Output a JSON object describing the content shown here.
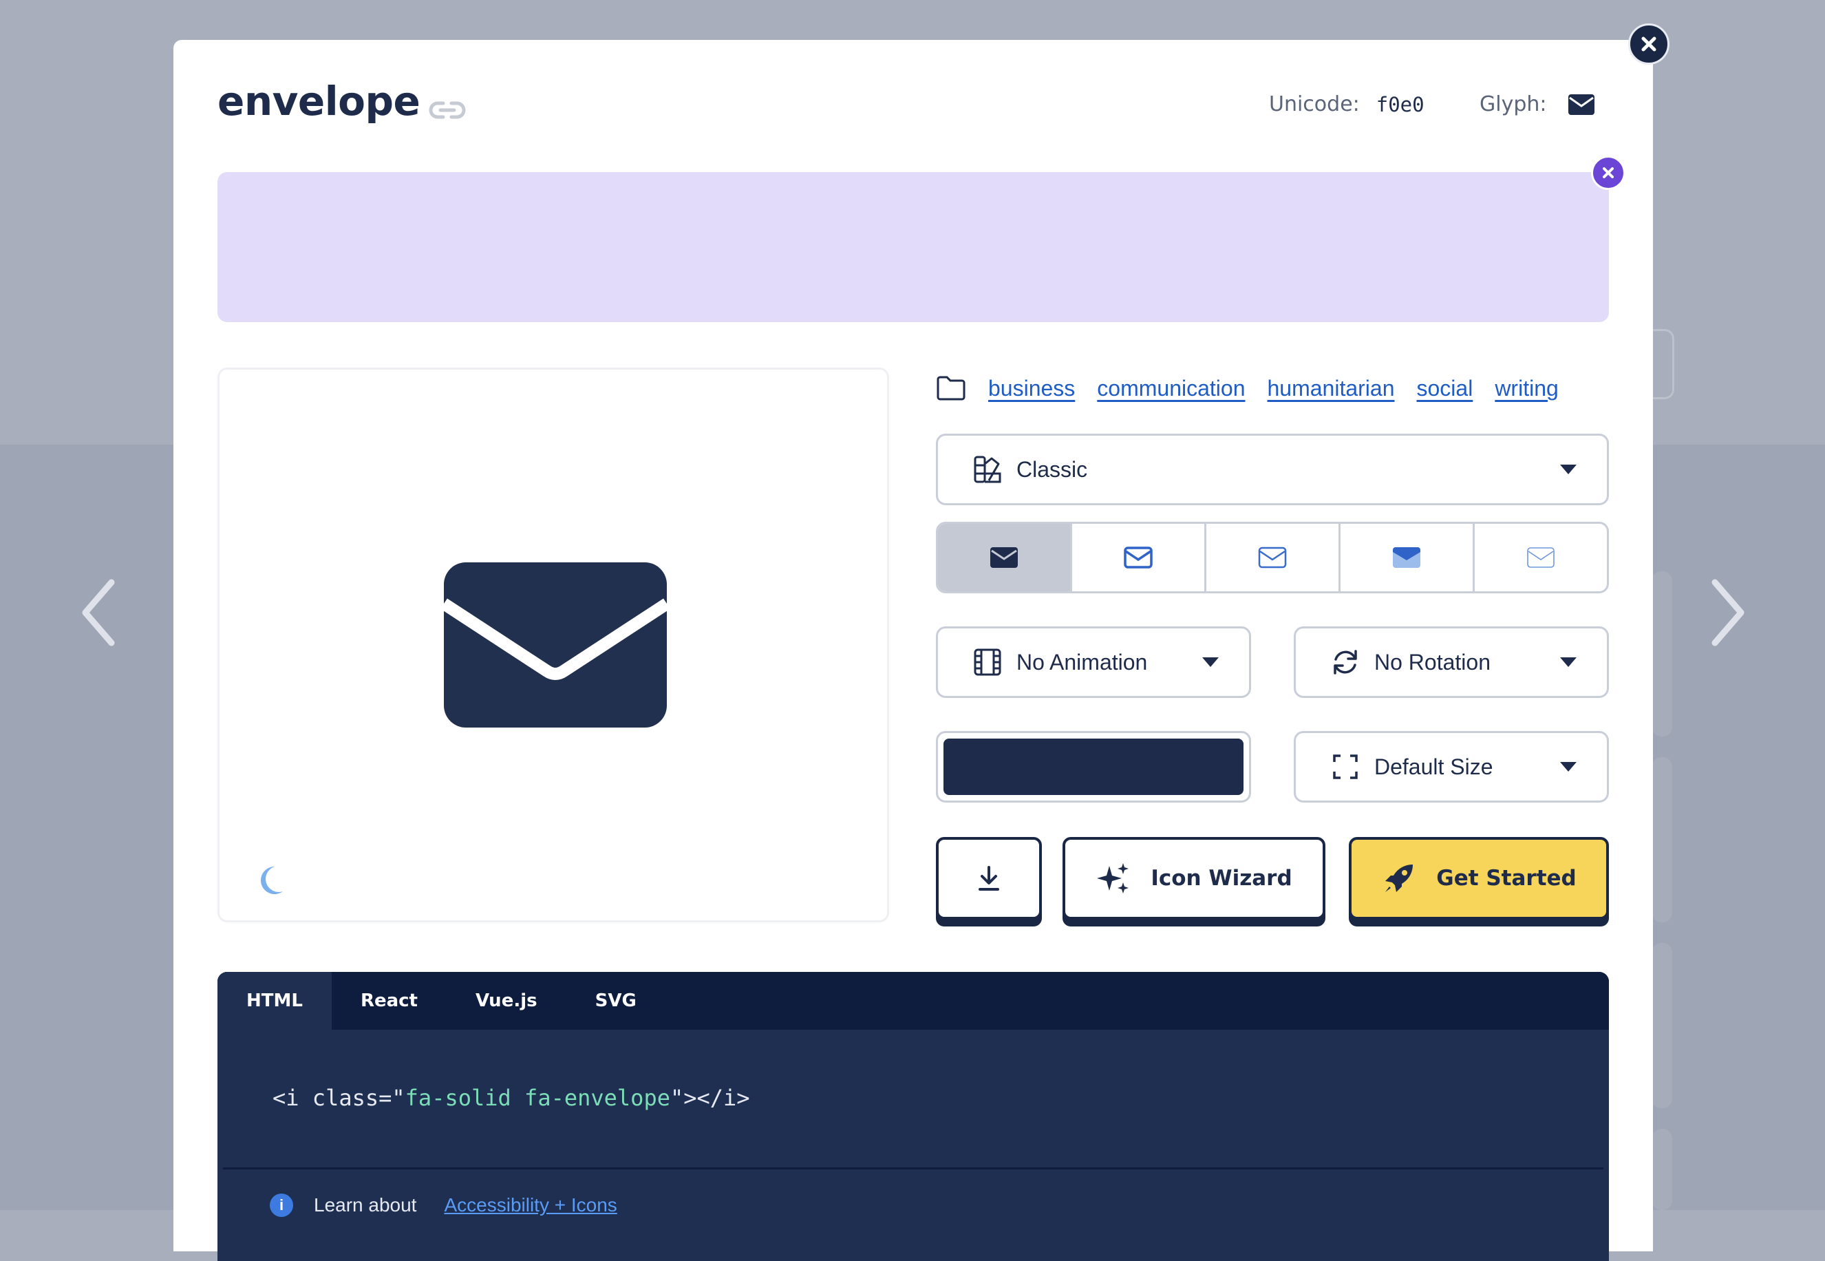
{
  "modal": {
    "icon_name": "envelope",
    "unicode_label": "Unicode:",
    "unicode_value": "f0e0",
    "glyph_label": "Glyph:"
  },
  "categories": [
    "business",
    "communication",
    "humanitarian",
    "social",
    "writing"
  ],
  "style_select": {
    "value": "Classic"
  },
  "variants": [
    "solid",
    "regular",
    "light",
    "duotone",
    "thin"
  ],
  "animation_select": {
    "value": "No Animation"
  },
  "rotation_select": {
    "value": "No Rotation"
  },
  "size_select": {
    "value": "Default Size"
  },
  "color": {
    "value": "#1e2b4a"
  },
  "buttons": {
    "icon_wizard": "Icon Wizard",
    "get_started": "Get Started"
  },
  "code": {
    "tabs": [
      "HTML",
      "React",
      "Vue.js",
      "SVG"
    ],
    "active_tab": "HTML",
    "line_prefix": "<i class=\"",
    "line_class": "fa-solid fa-envelope",
    "line_suffix": "\"></i>"
  },
  "learn": {
    "text": "Learn about",
    "link": "Accessibility + Icons"
  },
  "colors": {
    "accent": "#1e2b4a",
    "highlight": "#f6d55a",
    "banner": "#e2dcfa",
    "link": "#1f5cc4"
  }
}
